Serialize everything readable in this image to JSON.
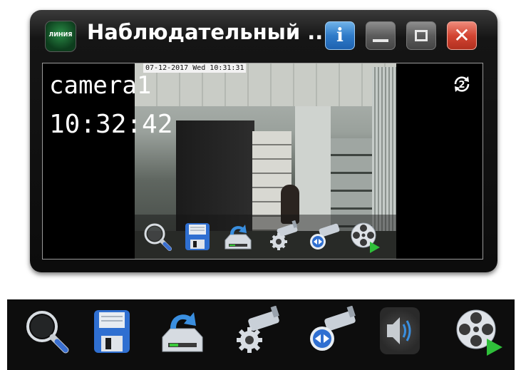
{
  "window": {
    "logo_text": "ЛИНИЯ",
    "title": "Наблюдательный ...",
    "info_icon": "i",
    "close_icon": "✕"
  },
  "video": {
    "osd_timestamp": "07-12-2017 Wed 10:31:31",
    "camera_name": "camera1",
    "time": "10:32:42",
    "camera_number": "2"
  },
  "icons": {
    "zoom": "magnifier-icon",
    "save": "floppy-disk-icon",
    "archive": "archive-download-icon",
    "ptz_settings": "camera-settings-icon",
    "ptz_control": "camera-ptz-icon",
    "sound": "speaker-icon",
    "playback": "film-reel-play-icon"
  },
  "colors": {
    "info_button": "#2f7bc9",
    "close_button": "#d34533",
    "window_bg": "#151515",
    "toolbar_bg": "#0d0d0d"
  }
}
